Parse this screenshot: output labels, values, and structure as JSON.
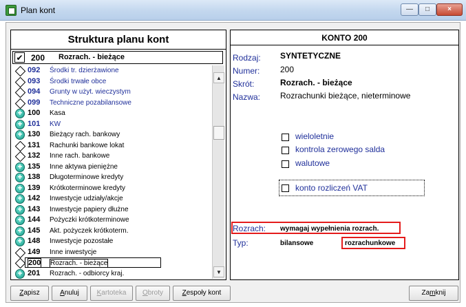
{
  "window": {
    "title": "Plan kont",
    "min_icon": "minimize-icon",
    "max_icon": "maximize-icon",
    "close_icon": "close-icon",
    "close_glyph": "×"
  },
  "left": {
    "title": "Struktura planu kont",
    "selected": {
      "number": "200",
      "name": "Rozrach. - bieżące",
      "check_glyph": "✔"
    },
    "items": [
      {
        "number": "092",
        "name": "Środki tr. dzierżawione",
        "icon": "diamond",
        "color": "blue"
      },
      {
        "number": "093",
        "name": "Środki trwałe obce",
        "icon": "diamond",
        "color": "blue"
      },
      {
        "number": "094",
        "name": "Grunty w użyt. wieczystym",
        "icon": "diamond",
        "color": "blue"
      },
      {
        "number": "099",
        "name": "Techniczne pozabilansowe",
        "icon": "diamond",
        "color": "blue"
      },
      {
        "number": "100",
        "name": "Kasa",
        "icon": "plus",
        "color": "black"
      },
      {
        "number": "101",
        "name": "KW",
        "icon": "plus",
        "color": "blue"
      },
      {
        "number": "130",
        "name": "Bieżący rach. bankowy",
        "icon": "plus",
        "color": "black"
      },
      {
        "number": "131",
        "name": "Rachunki bankowe lokat",
        "icon": "diamond",
        "color": "black"
      },
      {
        "number": "132",
        "name": "Inne rach. bankowe",
        "icon": "diamond",
        "color": "black"
      },
      {
        "number": "135",
        "name": "Inne aktywa pieniężne",
        "icon": "plus",
        "color": "black"
      },
      {
        "number": "138",
        "name": "Długoterminowe kredyty",
        "icon": "plus",
        "color": "black"
      },
      {
        "number": "139",
        "name": "Krótkoterminowe kredyty",
        "icon": "plus",
        "color": "black"
      },
      {
        "number": "142",
        "name": "Inwestycje udziały/akcje",
        "icon": "plus",
        "color": "black"
      },
      {
        "number": "143",
        "name": "Inwestycje papiery dłużne",
        "icon": "plus",
        "color": "black"
      },
      {
        "number": "144",
        "name": "Pożyczki krótkoterminowe",
        "icon": "plus",
        "color": "black"
      },
      {
        "number": "145",
        "name": "Akt. pożyczek krótkoterm.",
        "icon": "plus",
        "color": "black"
      },
      {
        "number": "148",
        "name": "Inwestycje pozostałe",
        "icon": "plus",
        "color": "black"
      },
      {
        "number": "149",
        "name": "Inne inwestycje",
        "icon": "diamond",
        "color": "black"
      },
      {
        "number": "200",
        "name": "Rozrach. - bieżące",
        "icon": "diamond",
        "color": "black",
        "current": true
      },
      {
        "number": "201",
        "name": "Rozrach. - odbiorcy kraj.",
        "icon": "plus",
        "color": "black"
      }
    ],
    "scroll_up": "▲",
    "scroll_down": "▼"
  },
  "right": {
    "title": "KONTO  200",
    "fields": {
      "rodzaj_label": "Rodzaj:",
      "rodzaj": "SYNTETYCZNE",
      "numer_label": "Numer:",
      "numer": "200",
      "skrot_label": "Skrót:",
      "skrot": "Rozrach. - bieżące",
      "nazwa_label": "Nazwa:",
      "nazwa": "Rozrachunki bieżące, nieterminowe"
    },
    "checkboxes": [
      "wieloletnie",
      "kontrola zerowego salda",
      "walutowe"
    ],
    "vat_checkbox": "konto rozliczeń VAT",
    "rozrach_label": "Rozrach:",
    "rozrach_value": "wymagaj wypełnienia rozrach.",
    "typ_label": "Typ:",
    "typ_bilansowe": "bilansowe",
    "typ_rozrachunkowe": "rozrachunkowe"
  },
  "buttons": {
    "zapisz": {
      "u": "Z",
      "rest": "apisz"
    },
    "anuluj": {
      "u": "A",
      "rest": "nuluj"
    },
    "kartoteka": {
      "u": "K",
      "rest": "artoteka"
    },
    "obroty": {
      "u": "O",
      "rest": "broty"
    },
    "zespoly": {
      "u": "Z",
      "rest": "espoły kont"
    },
    "zamknij": {
      "pre": "Za",
      "u": "m",
      "rest": "knij"
    }
  }
}
